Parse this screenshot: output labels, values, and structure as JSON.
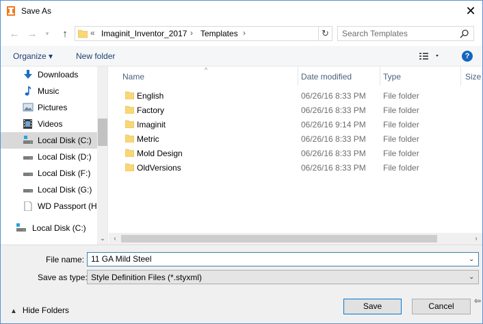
{
  "window": {
    "title": "Save As"
  },
  "address": {
    "overflow": "«",
    "parts": [
      "Imaginit_Inventor_2017",
      "Templates"
    ],
    "separator": "›"
  },
  "search": {
    "placeholder": "Search Templates"
  },
  "toolbar": {
    "organize_label": "Organize ▾",
    "new_folder_label": "New folder",
    "help_label": "?"
  },
  "nav": {
    "items": [
      {
        "label": "Downloads",
        "icon": "download-icon"
      },
      {
        "label": "Music",
        "icon": "music-icon"
      },
      {
        "label": "Pictures",
        "icon": "pictures-icon"
      },
      {
        "label": "Videos",
        "icon": "videos-icon"
      },
      {
        "label": "Local Disk (C:)",
        "icon": "drive-icon",
        "selected": true
      },
      {
        "label": "Local Disk (D:)",
        "icon": "drive-icon"
      },
      {
        "label": "Local Disk (F:)",
        "icon": "drive-icon"
      },
      {
        "label": "Local Disk (G:)",
        "icon": "drive-icon"
      },
      {
        "label": "WD Passport (H:",
        "icon": "file-drive-icon"
      },
      {
        "label": "Local Disk (C:)",
        "icon": "network-drive-icon"
      }
    ]
  },
  "columns": {
    "name": "Name",
    "date": "Date modified",
    "type": "Type",
    "size": "Size"
  },
  "files": [
    {
      "name": "English",
      "date": "06/26/16 8:33 PM",
      "type": "File folder"
    },
    {
      "name": "Factory",
      "date": "06/26/16 8:33 PM",
      "type": "File folder"
    },
    {
      "name": "Imaginit",
      "date": "06/26/16 9:14 PM",
      "type": "File folder"
    },
    {
      "name": "Metric",
      "date": "06/26/16 8:33 PM",
      "type": "File folder"
    },
    {
      "name": "Mold Design",
      "date": "06/26/16 8:33 PM",
      "type": "File folder"
    },
    {
      "name": "OldVersions",
      "date": "06/26/16 8:33 PM",
      "type": "File folder"
    }
  ],
  "form": {
    "filename_label": "File name:",
    "filename_value": "11 GA Mild Steel",
    "savetype_label": "Save as type:",
    "savetype_value": "Style Definition Files (*.styxml)"
  },
  "footer": {
    "hide_folders_label": "Hide Folders",
    "save_label": "Save",
    "cancel_label": "Cancel"
  },
  "colors": {
    "folder": "#f8d775",
    "accent": "#0078d7",
    "selected_bg": "#d9d9d9"
  }
}
